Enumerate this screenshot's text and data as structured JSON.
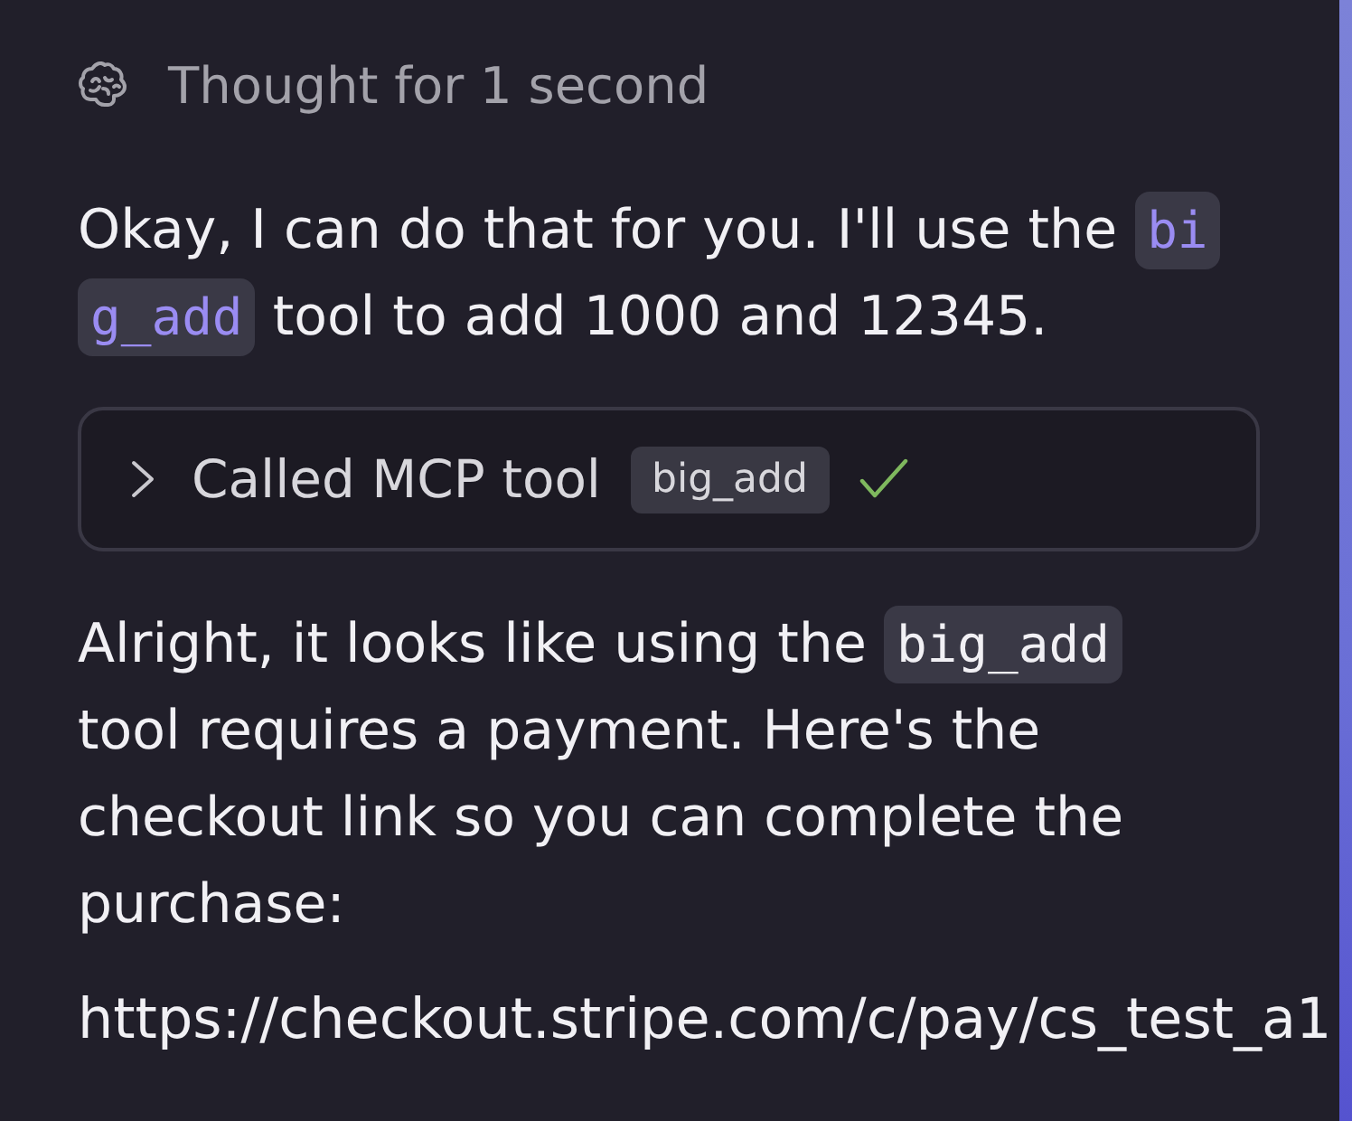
{
  "thought": {
    "label": "Thought for 1 second"
  },
  "messages": [
    {
      "kind": "paragraph",
      "segments": [
        {
          "kind": "text",
          "text": "Okay, I can do that for you. I'll use the "
        },
        {
          "kind": "tool_ref",
          "text": "big_add"
        },
        {
          "kind": "text",
          "text": " tool to add 1000 and 12345."
        }
      ]
    },
    {
      "kind": "tool_call",
      "label": "Called MCP tool",
      "tool": "big_add",
      "expanded": false,
      "succeeded": true
    },
    {
      "kind": "paragraph",
      "segments": [
        {
          "kind": "text",
          "text": "Alright, it looks like using the "
        },
        {
          "kind": "code",
          "text": "big_add"
        },
        {
          "kind": "text",
          "text": " tool requires a payment. Here's the checkout link so you can complete the purchase:"
        }
      ]
    },
    {
      "kind": "url",
      "text": "https://checkout.stripe.com/c/pay/cs_test_a1"
    }
  ]
}
